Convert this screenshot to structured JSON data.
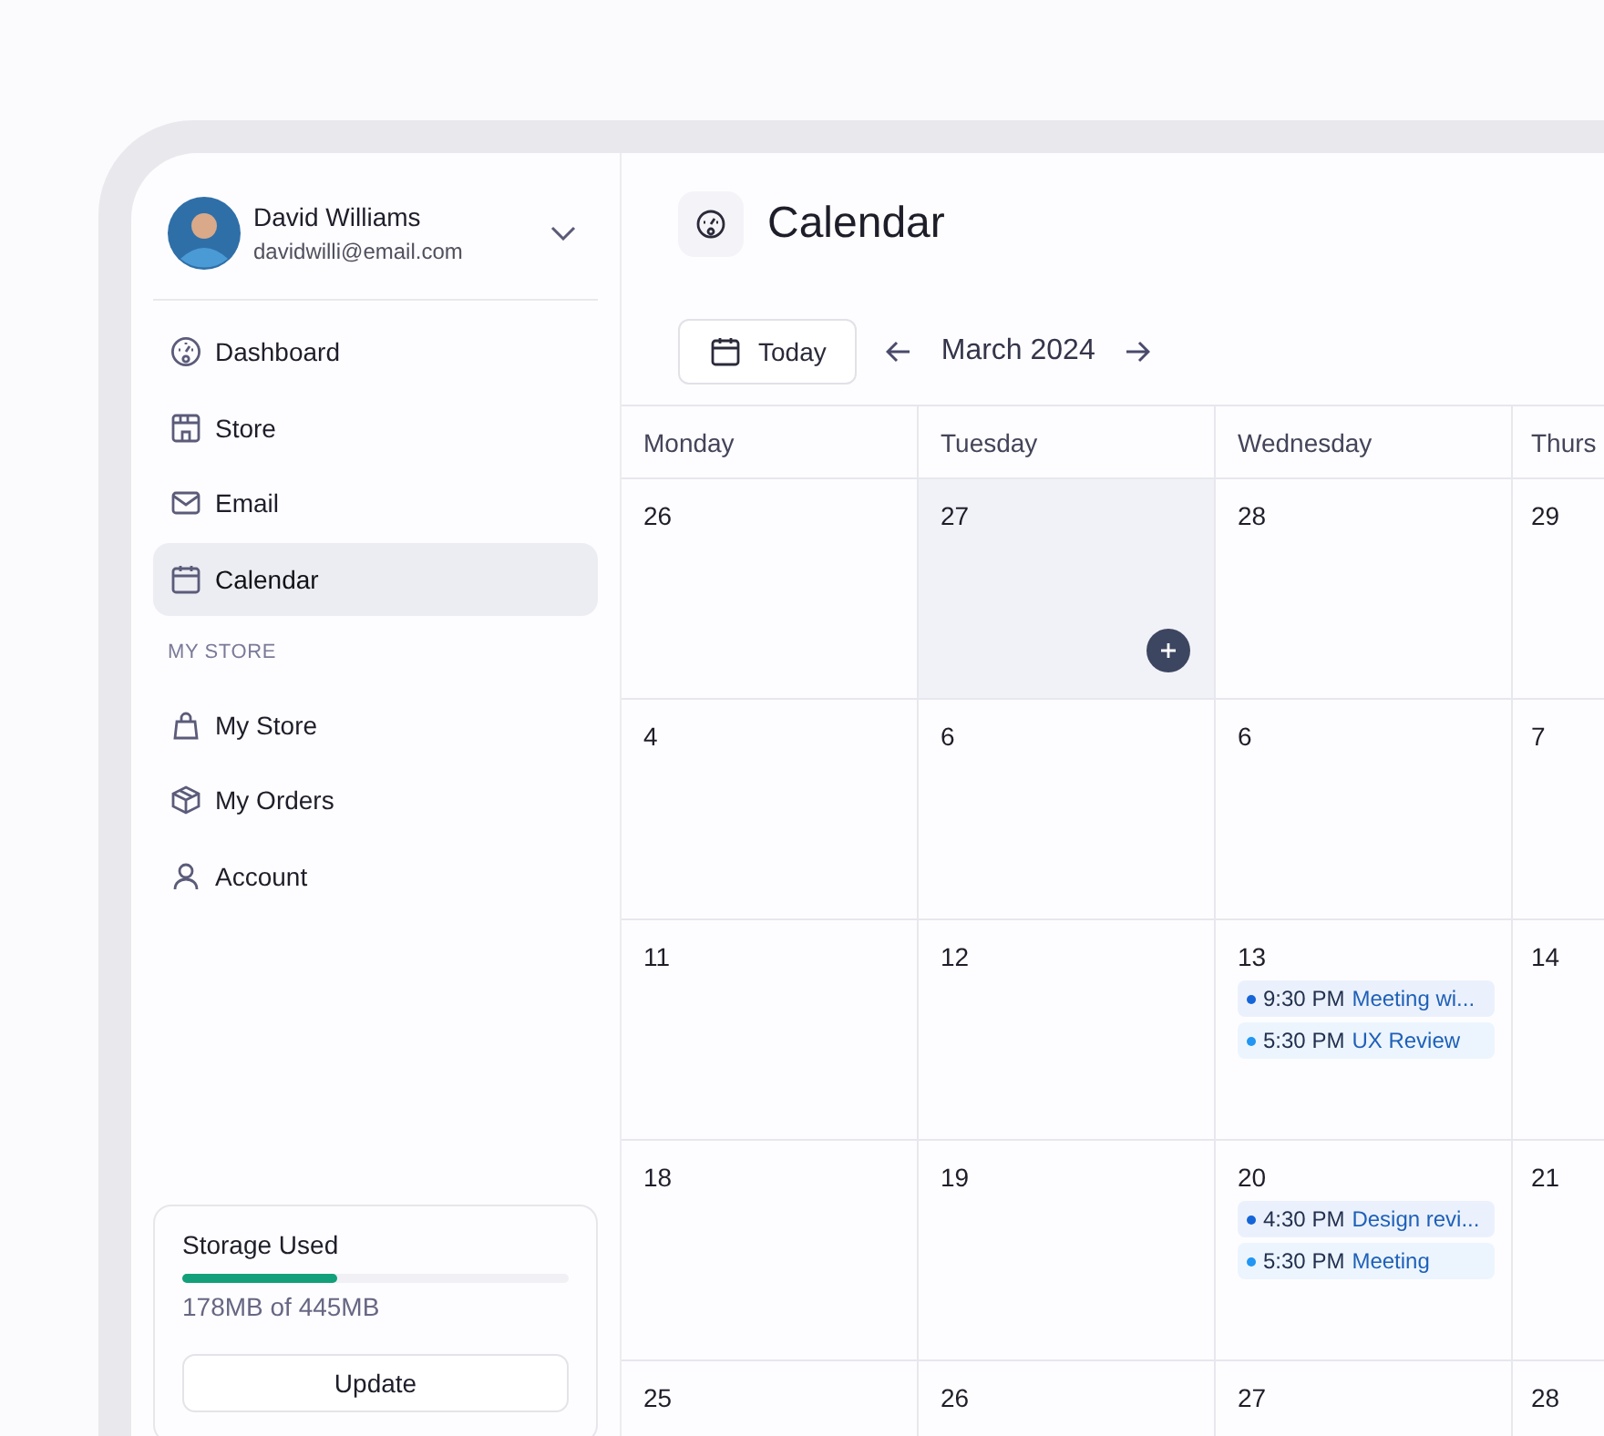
{
  "user": {
    "name": "David Williams",
    "email": "davidwilli@email.com"
  },
  "nav": [
    {
      "label": "Dashboard",
      "selected": false
    },
    {
      "label": "Store",
      "selected": false
    },
    {
      "label": "Email",
      "selected": false
    },
    {
      "label": "Calendar",
      "selected": true
    }
  ],
  "section_title": "MY STORE",
  "store_nav": [
    {
      "label": "My Store",
      "selected": false
    },
    {
      "label": "My Orders",
      "selected": false
    },
    {
      "label": "Account",
      "selected": false
    }
  ],
  "storage": {
    "title": "Storage Used",
    "level": 0.4,
    "reading": "178MB of 445MB",
    "button": "Update"
  },
  "page_title": "Calendar",
  "toolbar": {
    "today": "Today",
    "month": "March 2024"
  },
  "calendar": {
    "columns": [
      "Monday",
      "Tuesday",
      "Wednesday",
      "Thurs"
    ],
    "rows": [
      [
        {
          "day": "26",
          "highlighted": false
        },
        {
          "day": "27",
          "highlighted": true
        },
        {
          "day": "28",
          "highlighted": false
        },
        {
          "day": "29",
          "highlighted": false
        }
      ],
      [
        {
          "day": "4",
          "highlighted": false
        },
        {
          "day": "6",
          "highlighted": false
        },
        {
          "day": "6",
          "highlighted": false
        },
        {
          "day": "7",
          "highlighted": false
        }
      ],
      [
        {
          "day": "11",
          "highlighted": false
        },
        {
          "day": "12",
          "highlighted": false
        },
        {
          "day": "13",
          "highlighted": false,
          "events": [
            {
              "time": "9:30 PM",
              "title": "Meeting wi...",
              "color": "#1565d8"
            },
            {
              "time": "5:30 PM",
              "title": "UX Review",
              "color": "#2196f3"
            }
          ]
        },
        {
          "day": "14",
          "highlighted": false
        }
      ],
      [
        {
          "day": "18",
          "highlighted": false
        },
        {
          "day": "19",
          "highlighted": false
        },
        {
          "day": "20",
          "highlighted": false,
          "events": [
            {
              "time": "4:30 PM",
              "title": "Design revi...",
              "color": "#1565d8"
            },
            {
              "time": "5:30 PM",
              "title": "Meeting",
              "color": "#2196f3"
            }
          ]
        },
        {
          "day": "21",
          "highlighted": false
        }
      ],
      [
        {
          "day": "25",
          "highlighted": false
        },
        {
          "day": "26",
          "highlighted": false
        },
        {
          "day": "27",
          "highlighted": false
        },
        {
          "day": "28",
          "highlighted": false
        }
      ]
    ]
  }
}
